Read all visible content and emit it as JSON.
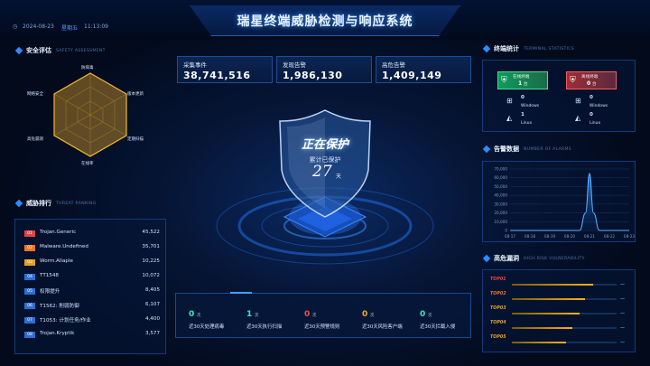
{
  "header": {
    "title": "瑞星终端威胁检测与响应系统",
    "date": "2024-08-23",
    "weekday": "星期五",
    "time": "11:13:09"
  },
  "safety": {
    "title": "安全评估",
    "subtitle": "SAFETY ASSESSMENT",
    "axes": [
      "防病毒",
      "版本更新",
      "定期扫描",
      "在线率",
      "高危漏洞",
      "网络安全"
    ]
  },
  "ranking": {
    "title": "威胁排行",
    "subtitle": "THREAT RANKING",
    "rows": [
      {
        "no": "01",
        "name": "Trojan.Generic",
        "count": "45,522",
        "color": "#e04545"
      },
      {
        "no": "02",
        "name": "Malware.Undefined",
        "count": "35,701",
        "color": "#e8762a"
      },
      {
        "no": "03",
        "name": "Worm.Allaple",
        "count": "10,225",
        "color": "#e0a12a"
      },
      {
        "no": "04",
        "name": "TT1548",
        "count": "10,072",
        "color": "#2d6fd2"
      },
      {
        "no": "05",
        "name": "权限提升",
        "count": "8,405",
        "color": "#2d6fd2"
      },
      {
        "no": "06",
        "name": "T1562: 削弱防御",
        "count": "6,107",
        "color": "#2d6fd2"
      },
      {
        "no": "07",
        "name": "T1053: 计划任务/作业",
        "count": "4,400",
        "color": "#2d6fd2"
      },
      {
        "no": "08",
        "name": "Trojan.Kryptik",
        "count": "3,577",
        "color": "#2d6fd2"
      }
    ]
  },
  "stats": [
    {
      "label": "采集事件",
      "value": "38,741,516"
    },
    {
      "label": "发现告警",
      "value": "1,986,130"
    },
    {
      "label": "高危告警",
      "value": "1,409,149"
    }
  ],
  "shield": {
    "status": "正在保护",
    "desc": "累计已保护",
    "days": "27",
    "unit": "天"
  },
  "bottom": [
    {
      "value": "0",
      "unit": "次",
      "label": "近30天处理病毒",
      "color": "#3ee6c2"
    },
    {
      "value": "1",
      "unit": "次",
      "label": "近30天执行扫描",
      "color": "#3ee6c2"
    },
    {
      "value": "0",
      "unit": "次",
      "label": "近30天预警规则",
      "color": "#e85050"
    },
    {
      "value": "0",
      "unit": "次",
      "label": "近30天风险客户端",
      "color": "#f0b020"
    },
    {
      "value": "0",
      "unit": "次",
      "label": "近30天拦截入侵",
      "color": "#3ee6c2"
    }
  ],
  "terminal": {
    "title": "终端统计",
    "subtitle": "TERMINAL STATISTICS",
    "online_label": "在线终端",
    "online_value": "1",
    "offline_label": "离线终端",
    "offline_value": "0",
    "win_online": "0",
    "win_online_label": "Windows",
    "win_offline": "0",
    "win_offline_label": "Windows",
    "linux_online": "1",
    "linux_online_label": "Linux",
    "linux_offline": "0",
    "linux_offline_label": "Linux",
    "online_unit": "台",
    "offline_unit": "台"
  },
  "alarms": {
    "title": "告警数据",
    "subtitle": "NUMBER OF ALARMS"
  },
  "chart_data": {
    "type": "area",
    "x": [
      "08-17",
      "08-18",
      "08-19",
      "08-20",
      "08-21",
      "08-22",
      "08-23"
    ],
    "y": [
      0,
      0,
      0,
      0,
      0,
      0,
      0,
      20000,
      65000,
      20000,
      0,
      0,
      0
    ],
    "x_points": [
      0,
      1,
      2,
      3,
      3.5,
      3.8,
      4,
      4.2,
      4.5,
      5,
      6
    ],
    "series": [
      {
        "values": [
          0,
          0,
          0,
          0,
          0,
          20000,
          65000,
          20000,
          0,
          0,
          0
        ]
      }
    ],
    "yticks": [
      "0",
      "10,000",
      "20,000",
      "30,000",
      "40,000",
      "50,000",
      "60,000",
      "70,000"
    ],
    "ylim": [
      0,
      70000
    ],
    "grid": true
  },
  "vuln": {
    "title": "高危漏洞",
    "subtitle": "HIGH RISK VULNERABILITY",
    "rows": [
      {
        "tag": "TOP01",
        "color": "#e04545",
        "fill": 0.78
      },
      {
        "tag": "TOP02",
        "color": "#e8762a",
        "fill": 0.7
      },
      {
        "tag": "TOP03",
        "color": "#e0a12a",
        "fill": 0.65
      },
      {
        "tag": "TOP04",
        "color": "#e0a12a",
        "fill": 0.58
      },
      {
        "tag": "TOP05",
        "color": "#e0a12a",
        "fill": 0.52
      }
    ],
    "dash": "—"
  }
}
